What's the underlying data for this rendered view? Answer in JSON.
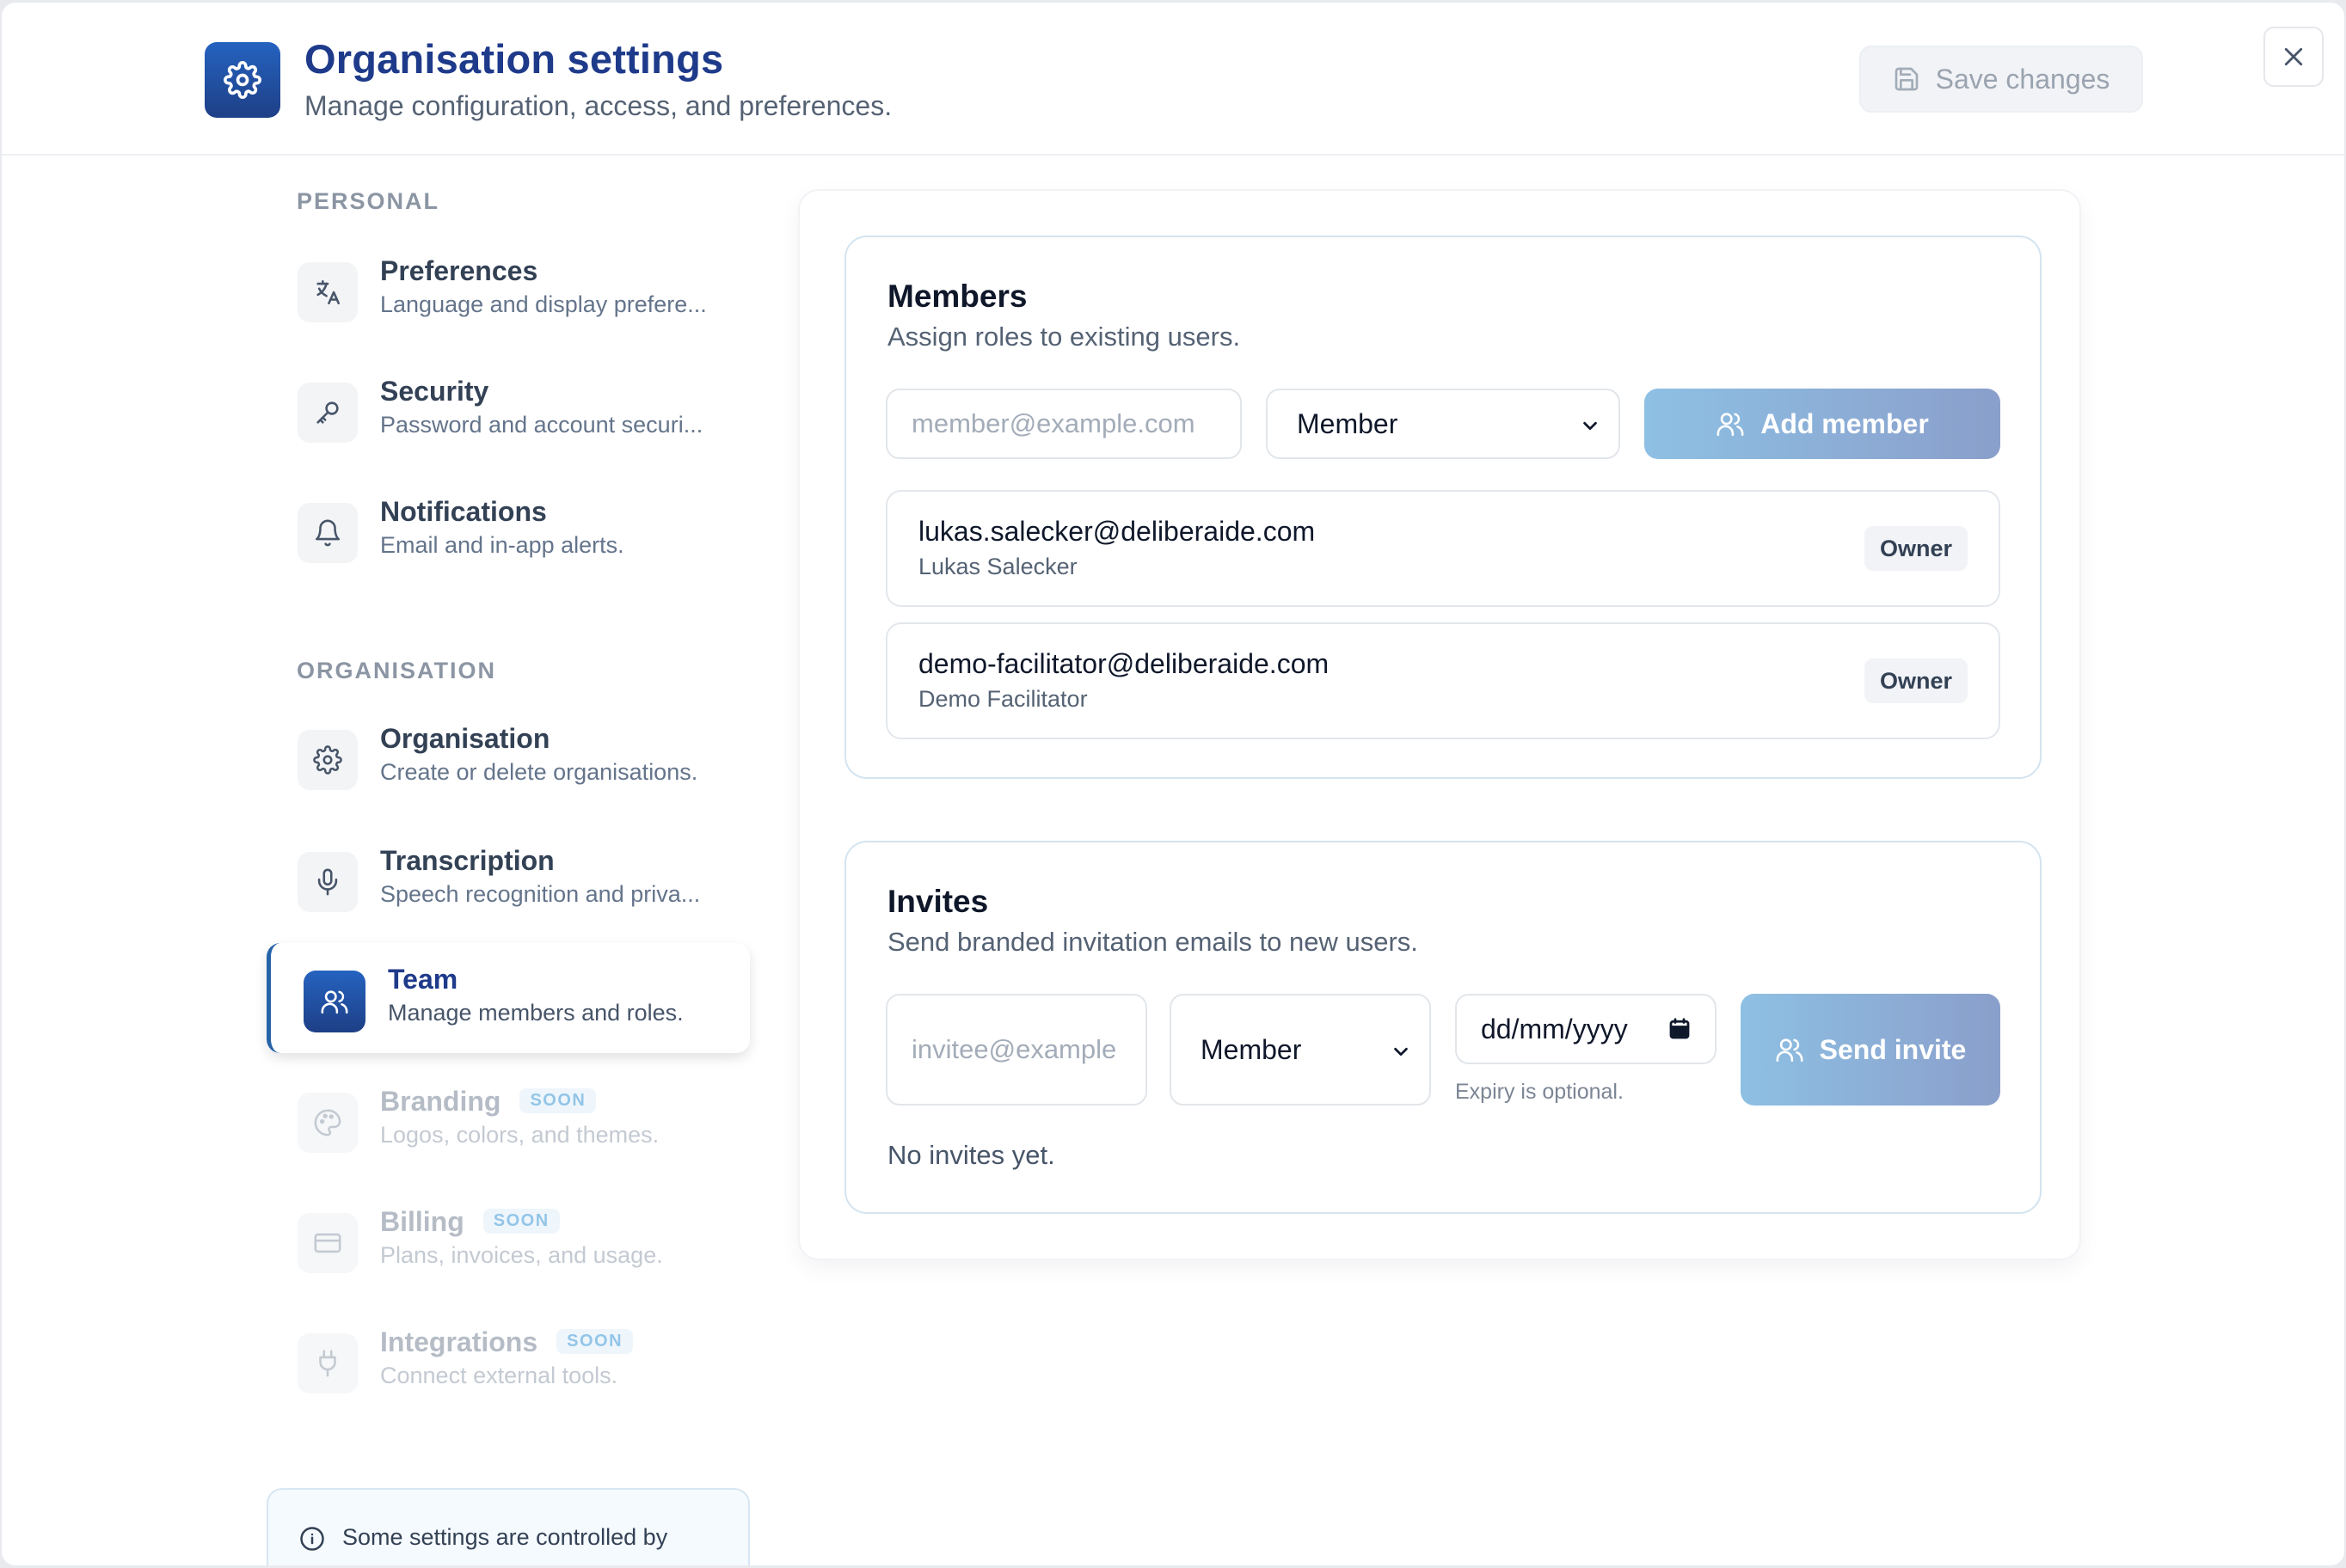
{
  "header": {
    "title": "Organisation settings",
    "subtitle": "Manage configuration, access, and preferences.",
    "save_label": "Save changes",
    "logo_icon": "gear-icon",
    "close_icon": "close-icon"
  },
  "sidebar": {
    "personal_label": "PERSONAL",
    "organisation_label": "ORGANISATION",
    "personal_items": [
      {
        "title": "Preferences",
        "desc": "Language and display prefere...",
        "icon": "translate-icon"
      },
      {
        "title": "Security",
        "desc": "Password and account securi...",
        "icon": "key-icon"
      },
      {
        "title": "Notifications",
        "desc": "Email and in-app alerts.",
        "icon": "bell-icon"
      }
    ],
    "organisation_items": [
      {
        "title": "Organisation",
        "desc": "Create or delete organisations.",
        "icon": "gear-icon"
      },
      {
        "title": "Transcription",
        "desc": "Speech recognition and priva...",
        "icon": "microphone-icon"
      },
      {
        "title": "Team",
        "desc": "Manage members and roles.",
        "icon": "users-icon",
        "active": true
      },
      {
        "title": "Branding",
        "desc": "Logos, colors, and themes.",
        "icon": "palette-icon",
        "badge": "SOON"
      },
      {
        "title": "Billing",
        "desc": "Plans, invoices, and usage.",
        "icon": "credit-card-icon",
        "badge": "SOON"
      },
      {
        "title": "Integrations",
        "desc": "Connect external tools.",
        "icon": "plug-icon",
        "badge": "SOON"
      }
    ],
    "info_text": "Some settings are controlled by"
  },
  "members": {
    "title": "Members",
    "subtitle": "Assign roles to existing users.",
    "email_placeholder": "member@example.com",
    "role_selected": "Member",
    "add_label": "Add member",
    "rows": [
      {
        "email": "lukas.salecker@deliberaide.com",
        "name": "Lukas Salecker",
        "role": "Owner"
      },
      {
        "email": "demo-facilitator@deliberaide.com",
        "name": "Demo Facilitator",
        "role": "Owner"
      }
    ]
  },
  "invites": {
    "title": "Invites",
    "subtitle": "Send branded invitation emails to new users.",
    "email_placeholder": "invitee@example",
    "role_selected": "Member",
    "date_placeholder": "dd/mm/yyyy",
    "expiry_hint": "Expiry is optional.",
    "send_label": "Send invite",
    "empty_text": "No invites yet."
  },
  "colors": {
    "brand": "#1e3a8a",
    "accent": "#2563a8",
    "button_gradient_start": "#8ec0e4",
    "button_gradient_end": "#8a9fcb"
  }
}
